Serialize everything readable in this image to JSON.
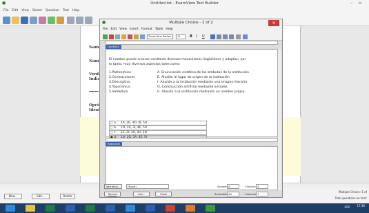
{
  "app": {
    "title": "Untitled.tst - ExamView Test Builder",
    "menu": [
      "File",
      "Edit",
      "View",
      "Select",
      "Question",
      "Test",
      "Help"
    ],
    "sidebar_labels": [
      "Name:",
      "Nami",
      "Verda",
      "Indicai",
      "Opción",
      "Identifi"
    ],
    "buttons": {
      "new": "New...",
      "edit": "Edit...",
      "delete": "Delete"
    },
    "status_line1": "Multiple Choice: 1 of",
    "status_line2": "Total questions on test:",
    "clock_time": "17:36",
    "clock_lang": "ESP"
  },
  "dialog": {
    "title": "Multiple Choice - 2 of 2",
    "close_glyph": "✕",
    "menu": [
      "File",
      "Edit",
      "View",
      "Insert",
      "Format",
      "Table",
      "Help"
    ],
    "font_name": "Times New Roman",
    "font_size": "11",
    "question_tab": "Question",
    "rationale_tab": "Rationale",
    "question_text_line1": "El nombre puede crearse mediante diversos mecanismos lingüísticos y adoptan, por",
    "question_text_line2": "lo tanto, muy diversos aspectos tales como:",
    "pairs_left": [
      "1.Patronímico",
      "2.Contracciones",
      "3.Descriptivo",
      "4.Toponímico",
      "5.Simbólico"
    ],
    "pairs_right": [
      "A. Enunciación sintética de los atributos de la institución",
      "E. Alusión al lugar de origen de la institución",
      "I.  Alusión a la institución mediante una imagen literaria",
      "O. Construcción artificial mediante iniciales",
      "U.  Alusión a la institución mediante un nombre propio"
    ],
    "options": [
      {
        "letter": "a.",
        "value": "1A, 2E, 3O, 4I, 5U"
      },
      {
        "letter": "b.",
        "value": "1O, 2A, 3I, 4E, 5U"
      },
      {
        "letter": "c.",
        "value": "1E, 2I, 3A, 4U, 5O"
      },
      {
        "letter": "d.",
        "value": "1U, 2O, 3A, 4E, 5I"
      }
    ],
    "bottom": {
      "narrative_btn": "Narrative...",
      "narrative_value": "(None)",
      "record_btn": "Record",
      "info_btn": "Info...",
      "close_btn": "Close",
      "answer_label": "Answer:",
      "answer_value": "d",
      "choices_label": "Choices:",
      "choices_value": "4",
      "scramble_label": "Scramble:",
      "scramble_value": "All",
      "columns_label": "Columns:",
      "columns_value": "1"
    }
  },
  "colors": {
    "taskbar": "#1f3e66",
    "close_red": "#c73b3b",
    "tab_blue": "#3a63b5"
  }
}
